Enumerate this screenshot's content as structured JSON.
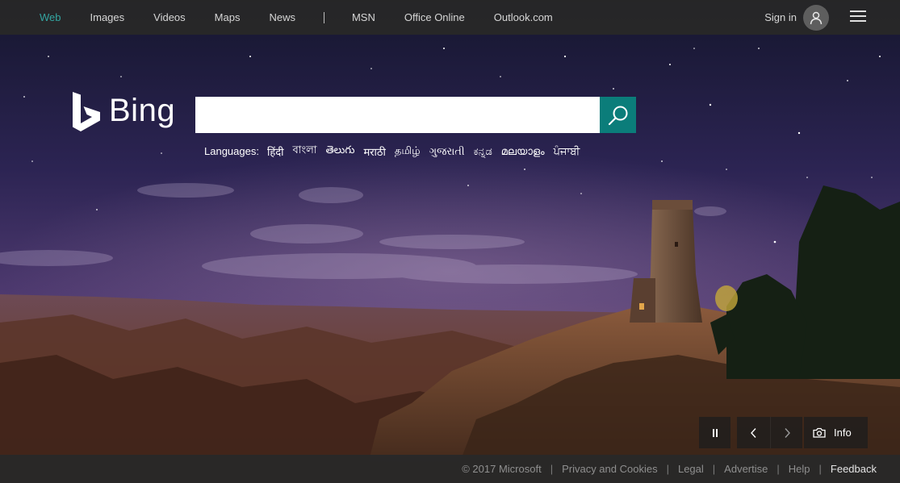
{
  "nav": {
    "links": [
      "Web",
      "Images",
      "Videos",
      "Maps",
      "News"
    ],
    "links2": [
      "MSN",
      "Office Online",
      "Outlook.com"
    ],
    "active": "Web",
    "signin_label": "Sign in"
  },
  "logo": {
    "text": "Bing"
  },
  "search": {
    "value": "",
    "placeholder": ""
  },
  "languages": {
    "label": "Languages:",
    "items": [
      "हिंदी",
      "বাংলা",
      "తెలుగు",
      "मराठी",
      "தமிழ்",
      "ગુજરાતી",
      "ಕನ್ನಡ",
      "മലയാളം",
      "ਪੰਜਾਬੀ"
    ]
  },
  "image_controls": {
    "info_label": "Info"
  },
  "footer": {
    "copyright": "© 2017 Microsoft",
    "links": [
      "Privacy and Cookies",
      "Legal",
      "Advertise",
      "Help",
      "Feedback"
    ]
  },
  "colors": {
    "accent": "#33a5a1",
    "search_button": "#0b7d7a",
    "bar_background": "#282828"
  },
  "icons": [
    "bing-logo-icon",
    "user-avatar-icon",
    "hamburger-menu-icon",
    "search-icon",
    "pause-icon",
    "chevron-left-icon",
    "chevron-right-icon",
    "camera-icon"
  ]
}
